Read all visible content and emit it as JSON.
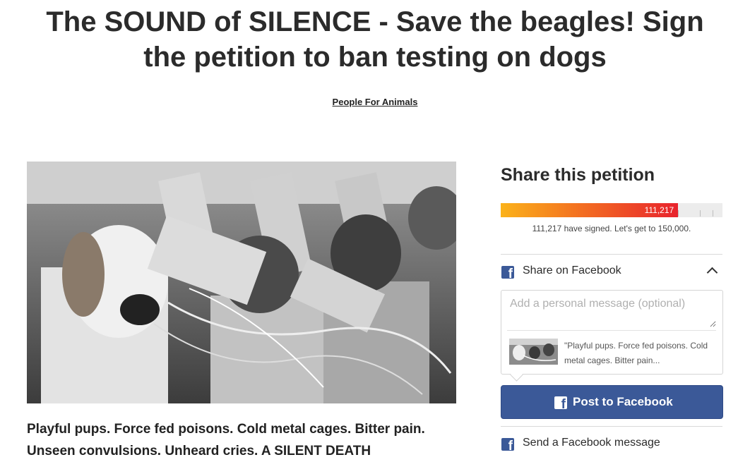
{
  "petition": {
    "title": "The SOUND of SILENCE - Save the beagles! Sign the petition to ban testing on dogs",
    "author": "People For Animals",
    "description": "Playful pups. Force fed poisons. Cold metal cages. Bitter pain. Unseen convulsions. Unheard cries. A SILENT DEATH"
  },
  "share": {
    "heading": "Share this petition",
    "progress": {
      "signed": 111217,
      "goal": 150000,
      "fraction": 0.8,
      "bar_label": "111,217",
      "caption": "111,217 have signed. Let's get to 150,000."
    },
    "facebook_share_label": "Share on Facebook",
    "message_placeholder": "Add a personal message (optional)",
    "preview_text": "\"Playful pups. Force fed poisons. Cold metal cages. Bitter pain...",
    "post_button_label": "Post to Facebook",
    "send_message_label": "Send a Facebook message"
  },
  "icons": {
    "facebook": "facebook-icon",
    "collapse": "chevron-up-icon"
  },
  "colors": {
    "facebook_blue": "#3b5998",
    "progress_start": "#fbb21a",
    "progress_end": "#e8232d",
    "text_dark": "#2b2b2b"
  }
}
